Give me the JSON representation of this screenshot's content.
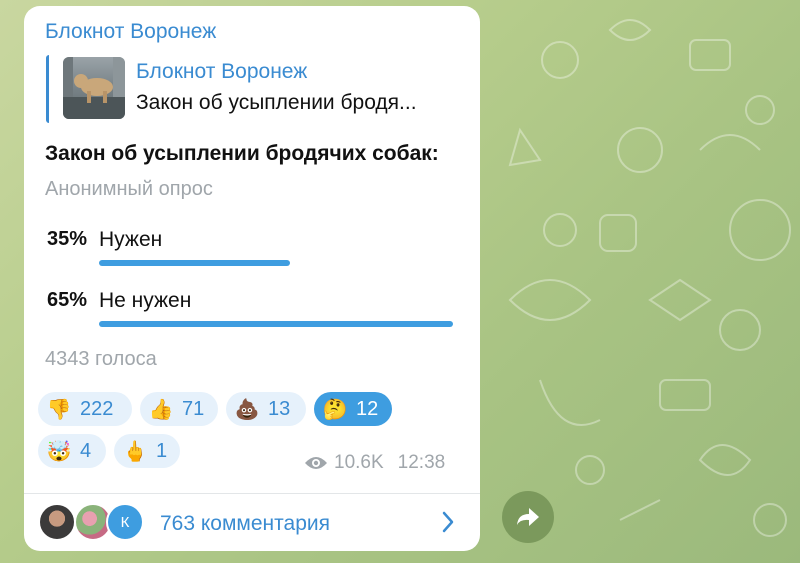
{
  "channel_name": "Блокнот Воронеж",
  "reply": {
    "title": "Блокнот Воронеж",
    "text": "Закон об усыплении бродя..."
  },
  "poll": {
    "question": "Закон об усыплении бродячих собак:",
    "type": "Анонимный опрос",
    "options": [
      {
        "percent": "35%",
        "label": "Нужен",
        "fraction": 0.35
      },
      {
        "percent": "65%",
        "label": "Не нужен",
        "fraction": 0.65
      }
    ],
    "votes": "4343 голоса"
  },
  "reactions": [
    {
      "emoji": "👎",
      "icon": "thumbs-down-icon",
      "count": "222",
      "active": false
    },
    {
      "emoji": "👍",
      "icon": "thumbs-up-icon",
      "count": "71",
      "active": false
    },
    {
      "emoji": "💩",
      "icon": "poop-icon",
      "count": "13",
      "active": false
    },
    {
      "emoji": "🤔",
      "icon": "thinking-face-icon",
      "count": "12",
      "active": true
    },
    {
      "emoji": "🤯",
      "icon": "exploding-head-icon",
      "count": "4",
      "active": false
    },
    {
      "emoji": "🖕",
      "icon": "middle-finger-icon",
      "count": "1",
      "active": false
    }
  ],
  "meta": {
    "views": "10.6K",
    "time": "12:38"
  },
  "comments": {
    "label": "763 комментария",
    "avatar_letter": "К"
  },
  "colors": {
    "accent": "#3a8bd1",
    "bar": "#3e9de0",
    "muted": "#a0a6ab"
  }
}
